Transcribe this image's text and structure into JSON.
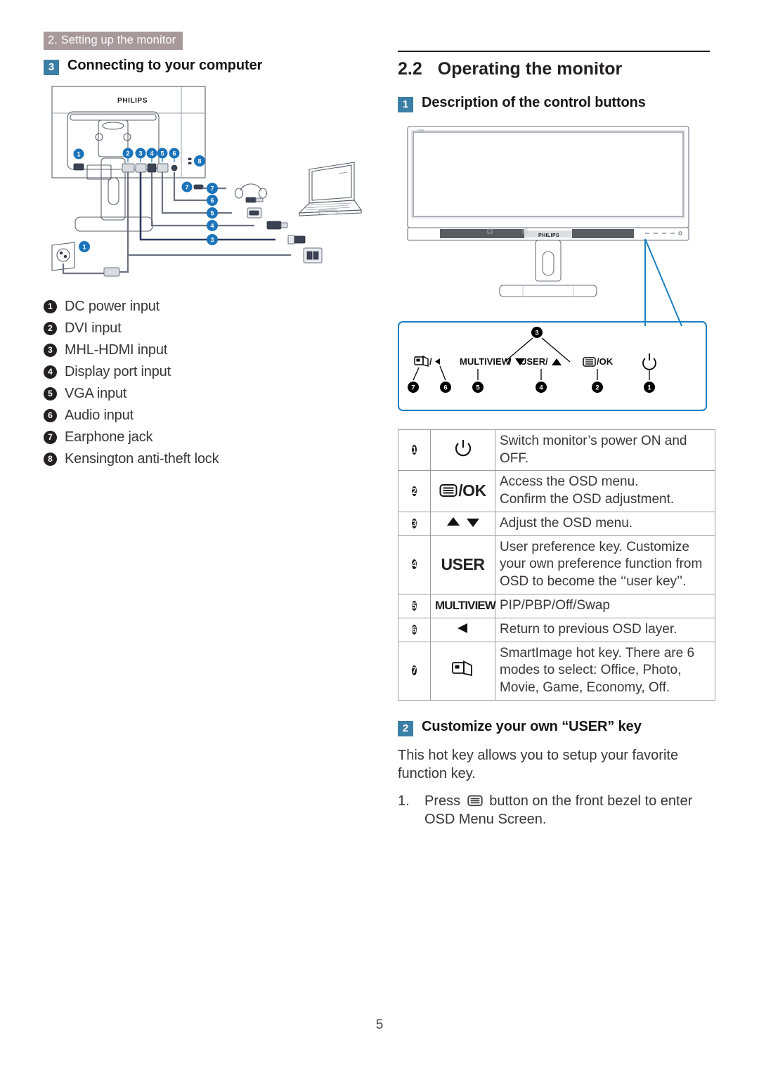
{
  "document": {
    "chapter_header": "2. Setting up the monitor",
    "page_number": "5"
  },
  "colors": {
    "chapter_band": "#a8999a",
    "square_badge": "#3b7ea6",
    "callout_border": "#1a7fc1",
    "round_badge": "#231f20",
    "body_text": "#3a3537",
    "table_border": "#9b9b9b"
  },
  "left_column": {
    "subhead": {
      "number": "3",
      "text": "Connecting to your computer"
    },
    "figure": {
      "name": "monitor-rear-connection-diagram",
      "brand_logo": "PHILIPS",
      "rear_port_callouts": [
        "2",
        "3",
        "4",
        "5",
        "6"
      ],
      "lock_callout": "8",
      "earphone_callout": "7",
      "power_callouts": [
        "1",
        "1"
      ],
      "cable_callouts": [
        "7",
        "6",
        "5",
        "4",
        "3"
      ],
      "devices": [
        "headphones",
        "audio-plug",
        "vga-connector",
        "displayport-connector",
        "hdmi-connector",
        "dvi-connector",
        "laptop",
        "wall-socket"
      ]
    },
    "ports": [
      {
        "num": "1",
        "label": "DC power input"
      },
      {
        "num": "2",
        "label": "DVI input"
      },
      {
        "num": "3",
        "label": "MHL-HDMI input"
      },
      {
        "num": "4",
        "label": "Display port input"
      },
      {
        "num": "5",
        "label": "VGA input"
      },
      {
        "num": "6",
        "label": "Audio input"
      },
      {
        "num": "7",
        "label": "Earphone jack"
      },
      {
        "num": "8",
        "label": "Kensington anti-theft lock"
      }
    ]
  },
  "right_column": {
    "section": {
      "number": "2.2",
      "title": "Operating the monitor"
    },
    "subhead_1": {
      "number": "1",
      "text": "Description of the control buttons"
    },
    "figure": {
      "name": "monitor-front-view",
      "brand_logo": "PHILIPS"
    },
    "callout": {
      "top_badge": "3",
      "buttons": [
        {
          "num": "7",
          "label": "/◀",
          "icon": "smartimage-icon"
        },
        {
          "num": "6",
          "label": "",
          "icon": ""
        },
        {
          "num": "5",
          "label": "MULTIVIEW /▼",
          "icon": ""
        },
        {
          "num": "4",
          "label": "USER /▲",
          "icon": ""
        },
        {
          "num": "2",
          "label": "/OK",
          "icon": "osd-menu-icon"
        },
        {
          "num": "1",
          "label": "",
          "icon": "power-icon"
        }
      ]
    },
    "table": {
      "rows": [
        {
          "num": "1",
          "icon_kind": "power",
          "icon_text": "⏻",
          "desc": "Switch monitor’s power ON and OFF."
        },
        {
          "num": "2",
          "icon_kind": "menu-ok",
          "icon_text": "/OK",
          "desc": "Access the OSD menu.\nConfirm the OSD adjustment."
        },
        {
          "num": "3",
          "icon_kind": "arrows",
          "icon_text": "▲ ▼",
          "desc": "Adjust the OSD menu."
        },
        {
          "num": "4",
          "icon_kind": "text",
          "icon_text": "USER",
          "desc": "User preference key. Customize your own preference function from OSD to become the ‘‘user key’’."
        },
        {
          "num": "5",
          "icon_kind": "text-small",
          "icon_text": "MULTIVIEW",
          "desc": "PIP/PBP/Off/Swap"
        },
        {
          "num": "6",
          "icon_kind": "arrow-left",
          "icon_text": "◀",
          "desc": "Return to previous OSD layer."
        },
        {
          "num": "7",
          "icon_kind": "smartimage",
          "icon_text": "",
          "desc": "SmartImage hot key. There are 6 modes to select: Office, Photo, Movie, Game, Economy, Off."
        }
      ]
    },
    "subhead_2": {
      "number": "2",
      "text": "Customize your own “USER” key"
    },
    "prose": "This hot key allows you to setup your favorite function key.",
    "step_1": {
      "number": "1.",
      "before_icon": "Press",
      "after_icon": "button on the front bezel to enter OSD Menu Screen."
    }
  }
}
